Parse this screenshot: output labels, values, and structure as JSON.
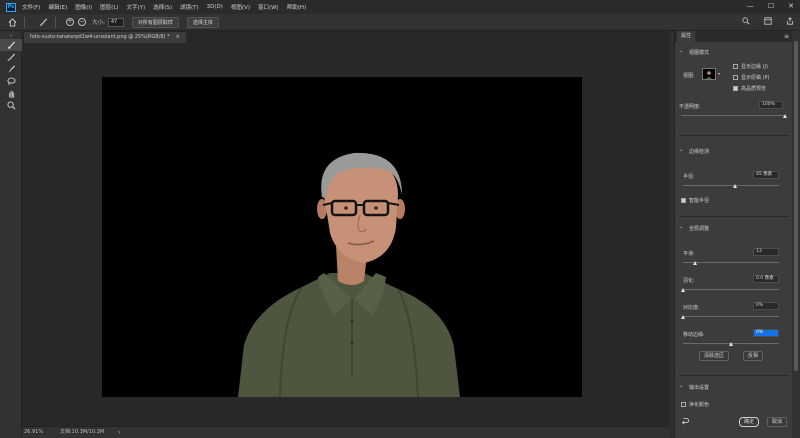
{
  "app": {
    "logo": "Ps"
  },
  "menu": [
    "文件(F)",
    "编辑(E)",
    "图像(I)",
    "图层(L)",
    "文字(Y)",
    "选择(S)",
    "滤镜(T)",
    "3D(D)",
    "视图(V)",
    "窗口(W)",
    "帮助(H)"
  ],
  "window_controls": {
    "minimize": "—",
    "maximize": "☐",
    "close": "✕"
  },
  "options": {
    "size_label": "大小:",
    "size_value": "47",
    "sample_all_layers": "对所有图层取样",
    "select_subject": "选择主体"
  },
  "document": {
    "tab_title": "foto-susto-tanaterpd1w4-unsolant.png @ 25%(RGB/8) *",
    "close": "×"
  },
  "status": {
    "zoom": "26.91%",
    "doc_size": "文档:10.3M/10.3M"
  },
  "panel": {
    "tab": "属性",
    "menu": "≡",
    "view_mode_label": "视图模式",
    "view_label": "视图:",
    "show_edge": "显示边缘 (J)",
    "show_original": "显示原稿 (P)",
    "high_quality_preview": "高品质预览",
    "transparency_label": "不透明度:",
    "transparency_value": "100%",
    "transparency_frac": 1.0,
    "edge_detection": "边缘检测",
    "radius_label": "半径:",
    "radius_value": "45 像素",
    "radius_frac": 0.55,
    "smart_radius": "智能半径",
    "global_refine": "全局调整",
    "smooth_label": "平滑:",
    "smooth_value": "13",
    "smooth_frac": 0.13,
    "feather_label": "羽化:",
    "feather_value": "0.0 像素",
    "feather_frac": 0.0,
    "contrast_label": "对比度:",
    "contrast_value": "0%",
    "contrast_frac": 0.0,
    "shift_edge_label": "移动边缘:",
    "shift_edge_value": "0%",
    "shift_edge_frac": 0.5,
    "clear_selection": "清除选区",
    "invert": "反相",
    "output_settings": "输出设置",
    "decontaminate": "净化颜色",
    "ok": "确定",
    "cancel": "取消"
  }
}
